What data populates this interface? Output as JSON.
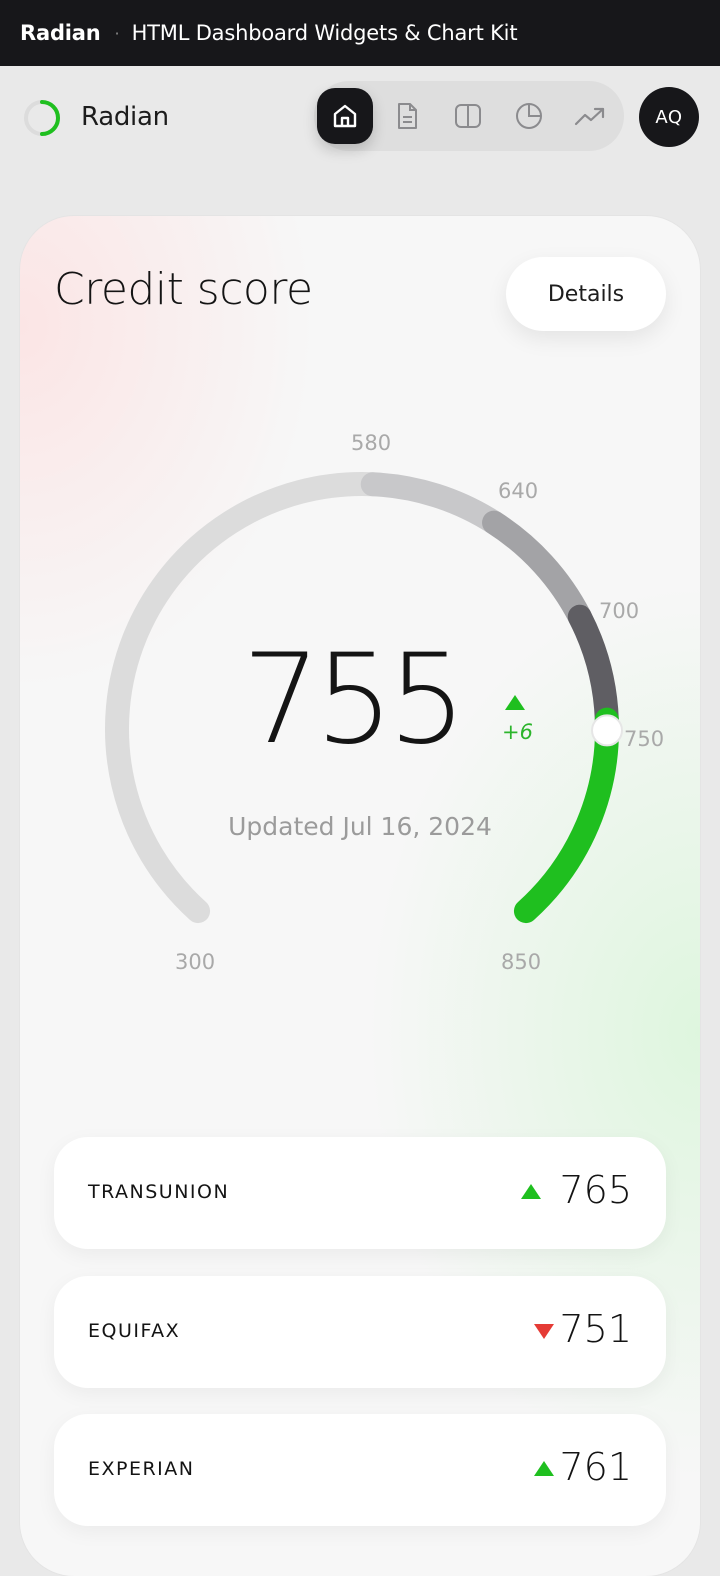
{
  "topbar": {
    "brand": "Radian",
    "separator": "·",
    "subtitle": "HTML Dashboard Widgets & Chart Kit"
  },
  "header": {
    "logo_text": "Radian",
    "avatar_initials": "AQ",
    "nav_icons": [
      "home-icon",
      "document-icon",
      "columns-icon",
      "pie-chart-icon",
      "trending-up-icon"
    ],
    "active_nav": "home-icon"
  },
  "card": {
    "title": "Credit score",
    "details_label": "Details"
  },
  "gauge": {
    "min": 300,
    "max": 850,
    "score": 755,
    "score_text": "755",
    "delta": "+6",
    "updated": "Updated Jul 16, 2024",
    "ticks": [
      "300",
      "580",
      "640",
      "700",
      "750",
      "850"
    ],
    "segments": [
      {
        "from": 300,
        "to": 580,
        "color": "#dcdcdc"
      },
      {
        "from": 580,
        "to": 640,
        "color": "#c8c8ca"
      },
      {
        "from": 640,
        "to": 700,
        "color": "#a3a3a6"
      },
      {
        "from": 700,
        "to": 750,
        "color": "#5f5e63"
      },
      {
        "from": 750,
        "to": 850,
        "color": "#1fbf1f"
      }
    ]
  },
  "bureaus": [
    {
      "name": "TRANSUNION",
      "value": "765",
      "trend": "up"
    },
    {
      "name": "EQUIFAX",
      "value": "751",
      "trend": "down"
    },
    {
      "name": "EXPERIAN",
      "value": "761",
      "trend": "up"
    }
  ],
  "colors": {
    "up": "#1fbf1f",
    "down": "#e53b35",
    "dark": "#17171a"
  }
}
